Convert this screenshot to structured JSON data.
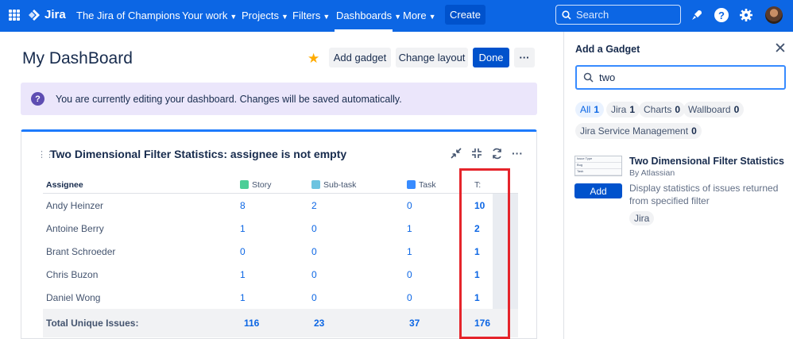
{
  "nav": {
    "product": "Jira",
    "site": "The Jira of Champions",
    "items": [
      {
        "label": "Your work"
      },
      {
        "label": "Projects"
      },
      {
        "label": "Filters"
      },
      {
        "label": "Dashboards"
      },
      {
        "label": "More"
      }
    ],
    "active_item": "Dashboards",
    "create_label": "Create",
    "search_placeholder": "Search",
    "icons": [
      "app-switcher-icon",
      "notifications-icon",
      "help-icon",
      "settings-icon",
      "avatar"
    ],
    "accent": "#0c66e4"
  },
  "dashboard": {
    "title": "My DashBoard",
    "buttons": {
      "add_gadget": "Add gadget",
      "change_layout": "Change layout",
      "done": "Done",
      "more": "···"
    },
    "banner": "You are currently editing your dashboard. Changes will be saved automatically."
  },
  "gadget": {
    "title": "Two Dimensional Filter Statistics: assignee is not empty",
    "headers": {
      "assignee": "Assignee",
      "story": "Story",
      "subtask": "Sub-task",
      "task": "Task",
      "total": "T:"
    },
    "rows": [
      {
        "name": "Andy Heinzer",
        "story": "8",
        "subtask": "2",
        "task": "0",
        "total": "10"
      },
      {
        "name": "Antoine Berry",
        "story": "1",
        "subtask": "0",
        "task": "1",
        "total": "2"
      },
      {
        "name": "Brant Schroeder",
        "story": "0",
        "subtask": "0",
        "task": "1",
        "total": "1"
      },
      {
        "name": "Chris Buzon",
        "story": "1",
        "subtask": "0",
        "task": "0",
        "total": "1"
      },
      {
        "name": "Daniel Wong",
        "story": "1",
        "subtask": "0",
        "task": "0",
        "total": "1"
      }
    ],
    "totals": {
      "label": "Total Unique Issues:",
      "story": "116",
      "subtask": "23",
      "task": "37",
      "total": "176"
    }
  },
  "panel": {
    "title": "Add a Gadget",
    "search_value": "two",
    "chips": [
      {
        "label": "All",
        "count": "1"
      },
      {
        "label": "Jira",
        "count": "1"
      },
      {
        "label": "Charts",
        "count": "0"
      },
      {
        "label": "Wallboard",
        "count": "0"
      },
      {
        "label": "Jira Service Management",
        "count": "0"
      }
    ],
    "result": {
      "name": "Two Dimensional Filter Statistics",
      "author": "By Atlassian",
      "description": "Display statistics of issues returned from specified filter",
      "tag": "Jira",
      "add_label": "Add",
      "thumb": [
        "Issue Type",
        "Bug",
        "Task"
      ]
    }
  }
}
